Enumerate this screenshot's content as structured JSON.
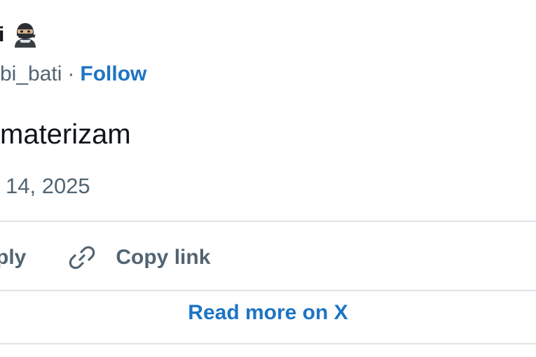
{
  "author": {
    "name_fragment": "i",
    "handle_fragment": "bi_bati",
    "separator": "·",
    "follow_label": "Follow"
  },
  "tweet": {
    "text_fragment": "materizam",
    "date_fragment": "14, 2025"
  },
  "actions": {
    "reply_fragment": "ply",
    "copy_link_label": "Copy link"
  },
  "footer": {
    "read_more_label": "Read more on X"
  },
  "colors": {
    "link_blue": "#1d74c4",
    "secondary_gray": "#536471",
    "divider": "#dde3e7"
  },
  "icons": {
    "author_emoji": "ninja-icon",
    "copy": "link-icon"
  }
}
